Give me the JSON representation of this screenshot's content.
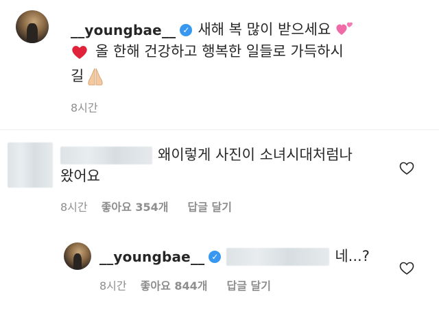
{
  "caption": {
    "username": "__youngbae__",
    "text_line1": "새해 복 많이 받으세요",
    "text_line2": "올 한해 건강하고 행복한 일들로 가득하시",
    "text_line3": "길",
    "time": "8시간"
  },
  "comment1": {
    "text_line1": "왜이렇게 사진이 소녀시대처럼나",
    "text_line2": "왔어요",
    "time": "8시간",
    "likes": "좋아요 354개",
    "reply_label": "답글 달기"
  },
  "reply1": {
    "username": "__youngbae__",
    "text": "네...?",
    "time": "8시간",
    "likes": "좋아요 844개",
    "reply_label": "답글 달기"
  },
  "colors": {
    "verified": "#3897f0",
    "meta": "#8e8e8e",
    "text": "#262626",
    "heart_emoji": "#e0233a",
    "pink_hearts": "#f06aa8"
  },
  "icons": {
    "verified": "verified-badge-icon",
    "heart": "heart-outline-icon",
    "praying_hands": "praying-hands-emoji",
    "two_hearts": "two-hearts-emoji",
    "red_heart": "red-heart-emoji"
  }
}
